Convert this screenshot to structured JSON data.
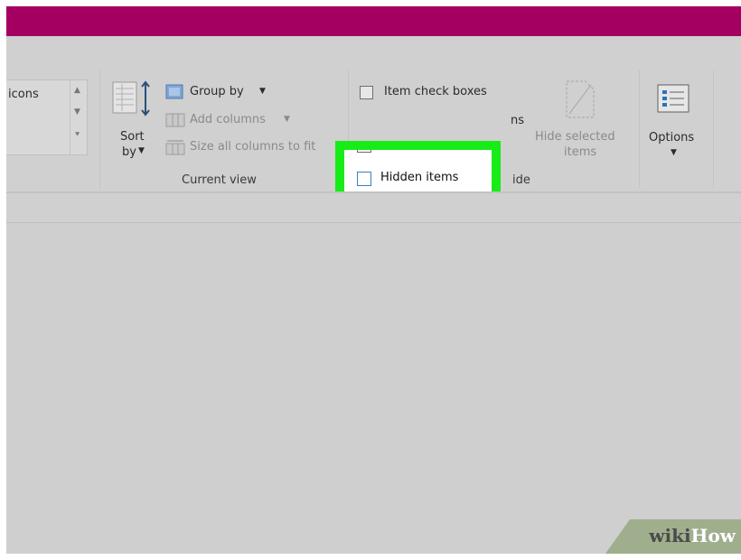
{
  "colors": {
    "titlebar": "#a40062",
    "highlight": "#18ec18",
    "ribbon": "#d0d0d0"
  },
  "layout_group": {
    "gallery_item_label": "icons"
  },
  "current_view": {
    "sort_label_1": "Sort",
    "sort_label_2": "by",
    "group_by_label": "Group by",
    "add_columns_label": "Add columns",
    "size_columns_label": "Size all columns to fit",
    "group_label": "Current view"
  },
  "show_hide": {
    "item_check_boxes_label": "Item check boxes",
    "partial_extensions_label": "ns",
    "hidden_items_label": "Hidden items",
    "hide_selected_label_1": "Hide selected",
    "hide_selected_label_2": "items",
    "group_label_partial": "ide"
  },
  "options": {
    "label": "Options"
  },
  "watermark": {
    "part1": "wiki",
    "part2": "How"
  },
  "icons": {
    "sort": "sort-by-icon",
    "group_by": "group-by-icon",
    "add_columns": "add-columns-icon",
    "size_columns": "size-columns-icon",
    "hide_selected": "hide-selected-icon",
    "options": "options-icon",
    "dropdown": "chevron-down-icon"
  }
}
